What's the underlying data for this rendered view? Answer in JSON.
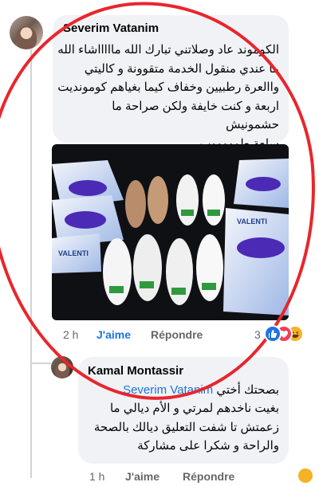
{
  "comment": {
    "author": "Severim Vatanim",
    "text_lines": [
      "الكوموند عاد وصلاتني تبارك الله ماااااشاء الله",
      "ما عندي منقول الخدمة متقوونة و كاليتي",
      "واالعرة رطبيين وخفاف كيما بغياهم كومونديت",
      "اربعة و كنت خايفة ولكن صراحة ما حشمونيش",
      "سلعة طوووووب"
    ],
    "photo": {
      "box_brand": "VALENTI",
      "description_icon": "product-photo"
    },
    "time": "2 h",
    "like_label": "J'aime",
    "reply_label": "Répondre",
    "reaction_count": "3",
    "reaction_icons": [
      "like-reaction-icon",
      "love-reaction-icon",
      "haha-reaction-icon"
    ]
  },
  "reply": {
    "author": "Kamal Montassir",
    "prefix": "بصحتك أختي",
    "mention": "Severim Vatanim",
    "text_lines": [
      "بغيت ناخدهم لمرتي و الأم ديالي ما",
      "زعمتش تا شفت التعليق ديالك بالصحة",
      "والراحة و شكرا على مشاركة"
    ],
    "time": "1 h",
    "like_label": "J'aime",
    "reply_label": "Répondre"
  },
  "colors": {
    "accent": "#1b74e4",
    "bubble": "#f0f2f5",
    "annotation": "#e8262c"
  }
}
